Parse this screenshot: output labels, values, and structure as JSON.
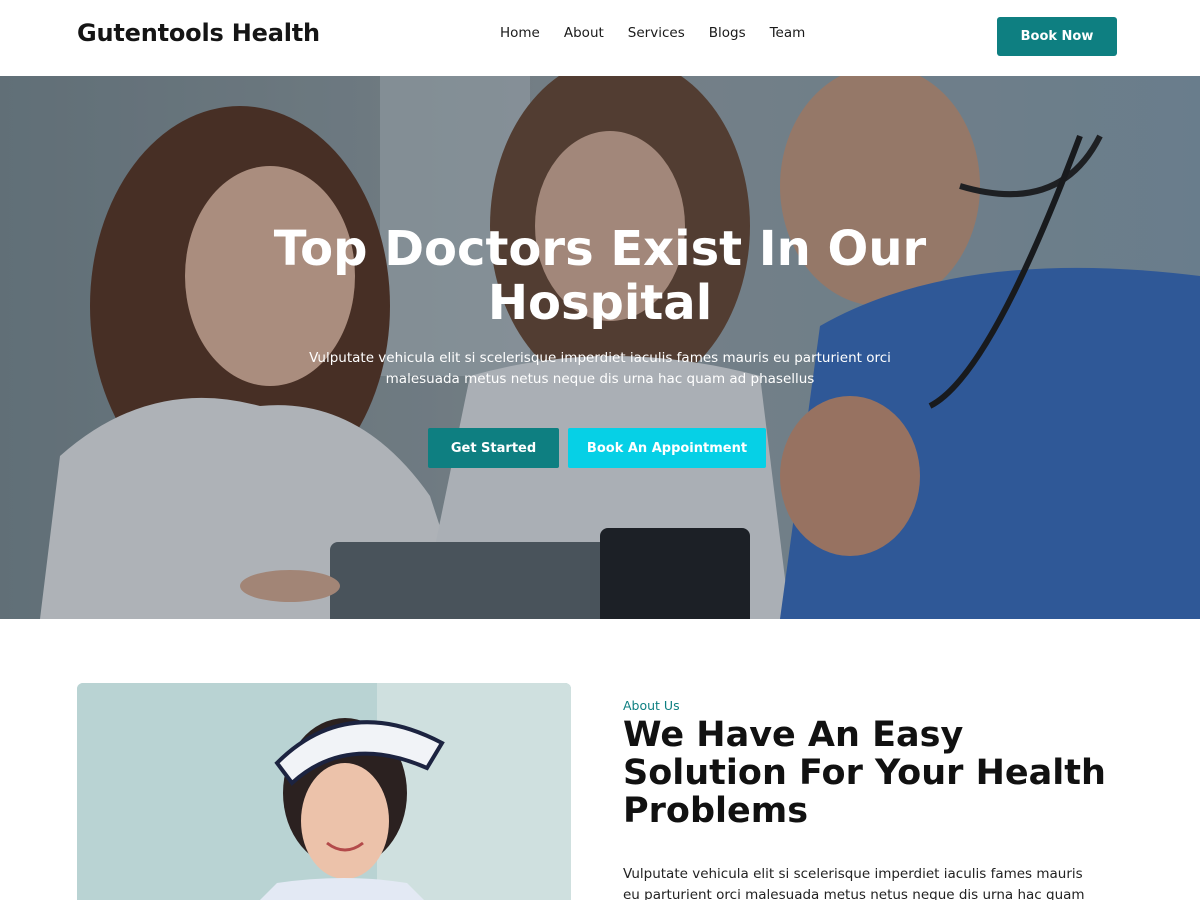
{
  "header": {
    "brand": "Gutentools Health",
    "nav": [
      "Home",
      "About",
      "Services",
      "Blogs",
      "Team"
    ],
    "cta_label": "Book Now"
  },
  "hero": {
    "title": "Top Doctors Exist In Our Hospital",
    "description": "Vulputate vehicula elit si scelerisque imperdiet iaculis fames mauris eu parturient orci malesuada metus netus neque dis urna hac quam ad phasellus",
    "primary_button": "Get Started",
    "secondary_button": "Book An Appointment"
  },
  "about": {
    "label": "About Us",
    "title": "We Have An Easy Solution For Your Health Problems",
    "text": "Vulputate vehicula elit si scelerisque imperdiet iaculis fames mauris eu parturient orci malesuada metus netus neque dis urna hac quam ad"
  },
  "colors": {
    "primary": "#0e7f81",
    "accent": "#06d0e6",
    "white": "#ffffff"
  }
}
